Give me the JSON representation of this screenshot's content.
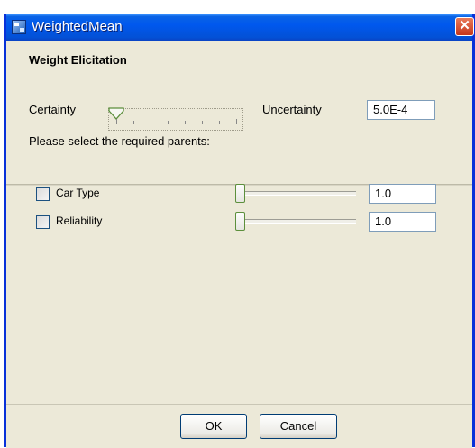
{
  "window": {
    "title": "WeightedMean",
    "close_label": "✕"
  },
  "weight_elicitation": {
    "heading": "Weight Elicitation",
    "certainty_label": "Certainty",
    "uncertainty_label": "Uncertainty",
    "uncertainty_value": "5.0E-4",
    "slider_level": 0,
    "instruction": "Please select the required parents:"
  },
  "parents": [
    {
      "label": "Car Type",
      "checked": false,
      "weight": "1.0"
    },
    {
      "label": "Reliability",
      "checked": false,
      "weight": "1.0"
    }
  ],
  "buttons": {
    "ok": "OK",
    "cancel": "Cancel"
  },
  "icons": [
    "window-app-icon",
    "close-icon",
    "slider-pointer-icon"
  ]
}
